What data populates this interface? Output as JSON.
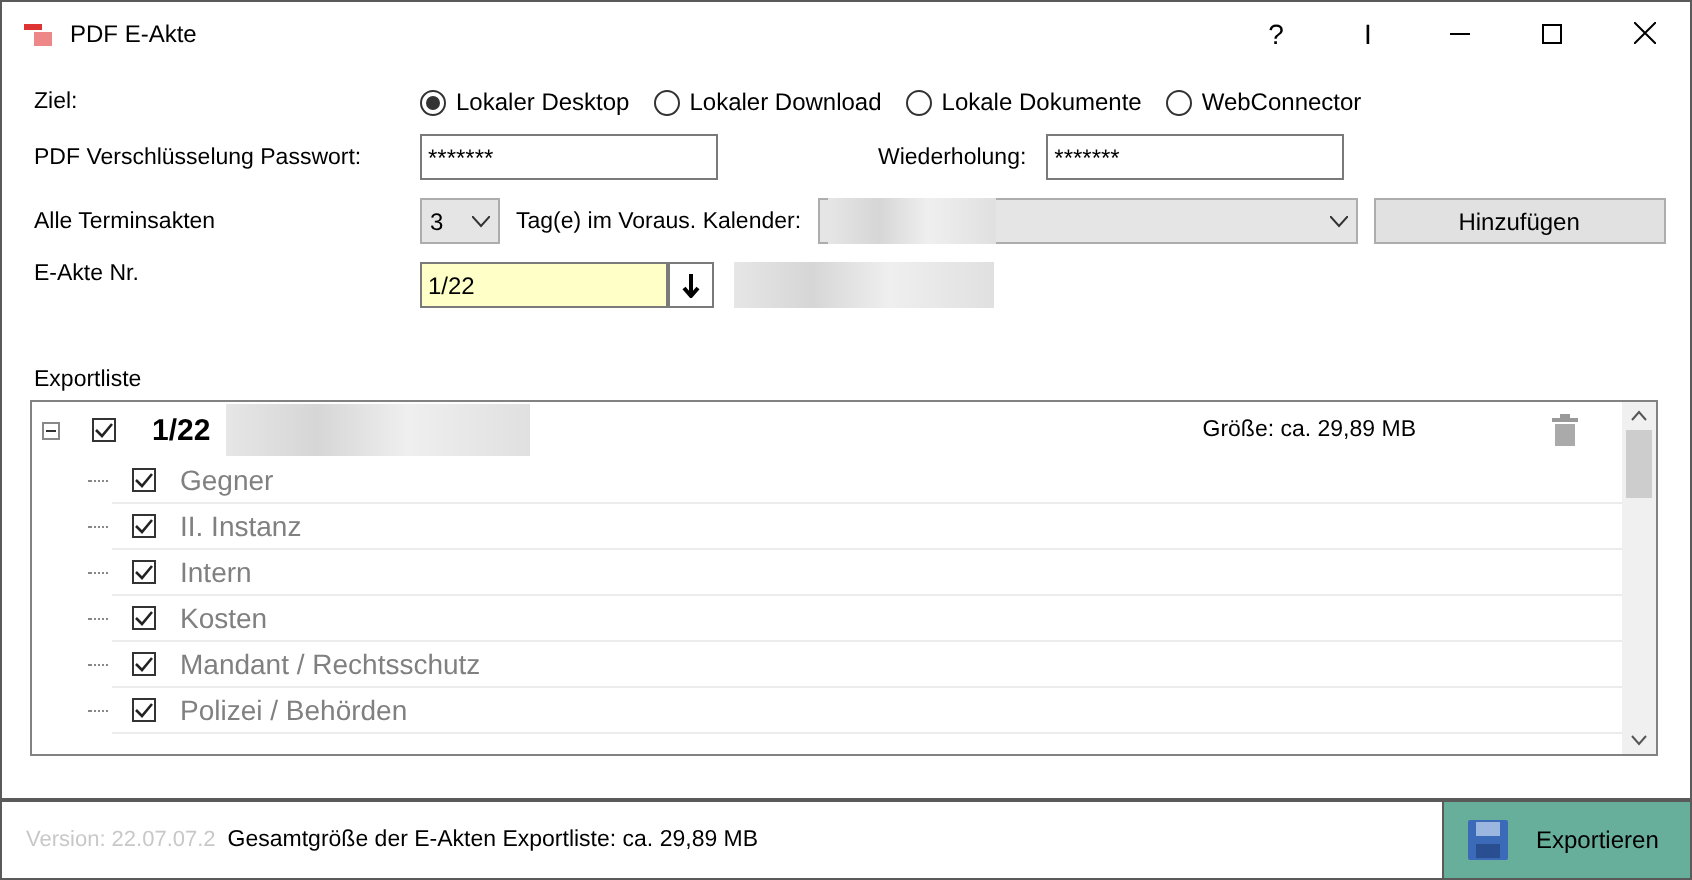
{
  "window": {
    "title": "PDF E-Akte",
    "buttons": [
      "?",
      "I"
    ]
  },
  "ziel": {
    "label": "Ziel:",
    "options": [
      {
        "label": "Lokaler Desktop",
        "selected": true
      },
      {
        "label": "Lokaler Download",
        "selected": false
      },
      {
        "label": "Lokale Dokumente",
        "selected": false
      },
      {
        "label": "WebConnector",
        "selected": false
      }
    ]
  },
  "password": {
    "label": "PDF Verschlüsselung Passwort:",
    "value": "*******",
    "repeat_label": "Wiederholung:",
    "repeat_value": "*******"
  },
  "termin": {
    "label": "Alle Terminsakten",
    "days": "3",
    "days_label": "Tag(e) im Voraus. Kalender:",
    "button": "Hinzufügen"
  },
  "akte": {
    "label": "E-Akte Nr.",
    "value": "1/22"
  },
  "export_list": {
    "label": "Exportliste",
    "root": {
      "title": "1/22",
      "checked": true,
      "expanded": true,
      "size": "Größe: ca. 29,89 MB",
      "children": [
        {
          "label": "Gegner",
          "checked": true
        },
        {
          "label": "II. Instanz",
          "checked": true
        },
        {
          "label": "Intern",
          "checked": true
        },
        {
          "label": "Kosten",
          "checked": true
        },
        {
          "label": "Mandant / Rechtsschutz",
          "checked": true
        },
        {
          "label": "Polizei / Behörden",
          "checked": true
        }
      ]
    }
  },
  "footer": {
    "version": "Version: 22.07.07.2",
    "total": "Gesamtgröße der E-Akten Exportliste: ca. 29,89 MB",
    "button": "Exportieren"
  }
}
